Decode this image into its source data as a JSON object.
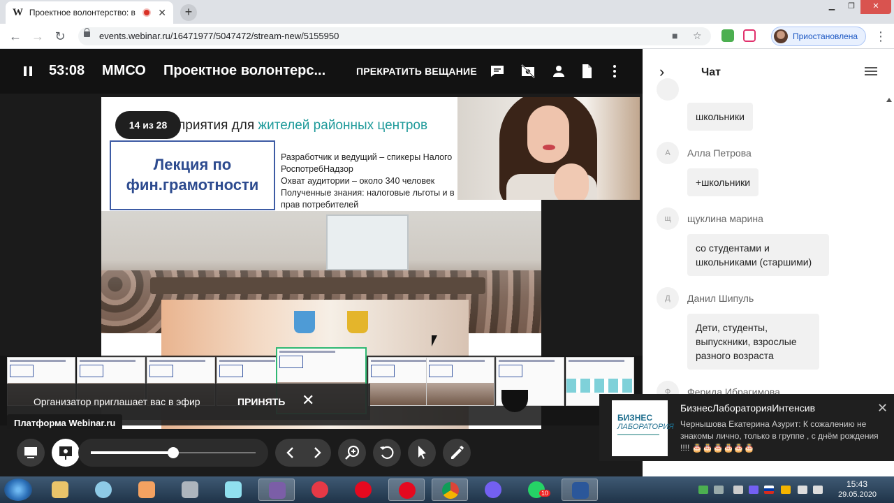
{
  "browser": {
    "tab_favicon": "W",
    "tab_title": "Проектное волонтерство: в",
    "url": "events.webinar.ru/16471977/5047472/stream-new/5155950",
    "profile_label": "Приостановлена"
  },
  "webinar": {
    "timer": "53:08",
    "organizer": "ММСО",
    "title": "Проектное волонтерс...",
    "stop_label": "ПРЕКРАТИТЬ ВЕЩАНИЕ"
  },
  "slide": {
    "counter": "14 из 28",
    "heading_prefix": "приятия для ",
    "heading_accent": "жителей районных центров",
    "box_text": "Лекция по фин.грамотности",
    "lines": [
      "Разработчик и ведущий – спикеры Налого",
      "РоспотребНадзор",
      "Охват аудитории – около 340 человек",
      "Полученные знания: налоговые льготы и в",
      "прав потребителей"
    ]
  },
  "invite": {
    "text": "Организатор приглашает вас в эфир",
    "accept": "ПРИНЯТЬ"
  },
  "platform_tip": "Платформа Webinar.ru",
  "toolbar": {
    "zoom_level": 0.5
  },
  "chat": {
    "title": "Чат",
    "messages": [
      {
        "avatar": "",
        "author": "",
        "text": "школьники"
      },
      {
        "avatar": "А",
        "author": "Алла Петрова",
        "text": "+школьники"
      },
      {
        "avatar": "щ",
        "author": "щуклина марина",
        "text": "со студентами и школьниками (старшими)"
      },
      {
        "avatar": "Д",
        "author": "Данил Шипуль",
        "text": "Дети, студенты, выпускники, взрослые разного возраста"
      },
      {
        "avatar": "Ф",
        "author": "Ферида Ибрагимова",
        "text": ""
      }
    ]
  },
  "notification": {
    "logo_line1": "БИЗНЕС",
    "logo_line2": "ЛАБОРАТОРИЯ",
    "title": "БизнесЛабораторияИнтенсив",
    "body": "Чернышова Екатерина Азурит: К сожалению не знакомы лично, только в группе , с днём рождения !!!! 🎂🎂🎂🎂🎂🎂"
  },
  "taskbar": {
    "whatsapp_badge": "10",
    "time": "15:43",
    "date": "29.05.2020"
  },
  "colors": {
    "accent_green": "#2eb872",
    "slide_accent": "#1e9a9a",
    "slide_blue": "#2d4b8f"
  }
}
